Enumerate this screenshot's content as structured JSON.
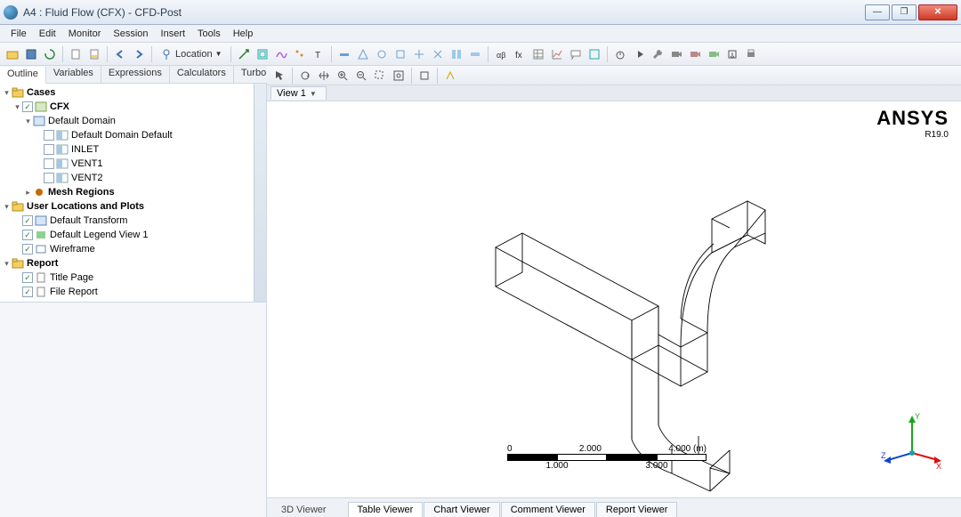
{
  "window": {
    "title": "A4 : Fluid Flow (CFX) - CFD-Post"
  },
  "menu": [
    "File",
    "Edit",
    "Monitor",
    "Session",
    "Insert",
    "Tools",
    "Help"
  ],
  "toolbar": {
    "location_label": "Location"
  },
  "left_tabs": [
    "Outline",
    "Variables",
    "Expressions",
    "Calculators",
    "Turbo"
  ],
  "left_active_tab": 0,
  "tree": [
    {
      "ind": 0,
      "tw": "▾",
      "ck": null,
      "ic": "folder",
      "lbl": "Cases",
      "bold": true
    },
    {
      "ind": 1,
      "tw": "▾",
      "ck": true,
      "ic": "case",
      "lbl": "CFX",
      "bold": true
    },
    {
      "ind": 2,
      "tw": "▾",
      "ck": null,
      "ic": "domain",
      "lbl": "Default Domain",
      "bold": false
    },
    {
      "ind": 3,
      "tw": "",
      "ck": false,
      "ic": "boundary",
      "lbl": "Default Domain Default",
      "bold": false
    },
    {
      "ind": 3,
      "tw": "",
      "ck": false,
      "ic": "boundary",
      "lbl": "INLET",
      "bold": false
    },
    {
      "ind": 3,
      "tw": "",
      "ck": false,
      "ic": "boundary",
      "lbl": "VENT1",
      "bold": false
    },
    {
      "ind": 3,
      "tw": "",
      "ck": false,
      "ic": "boundary",
      "lbl": "VENT2",
      "bold": false
    },
    {
      "ind": 2,
      "tw": "▸",
      "ck": null,
      "ic": "mesh",
      "lbl": "Mesh Regions",
      "bold": true
    },
    {
      "ind": 0,
      "tw": "▾",
      "ck": null,
      "ic": "folder",
      "lbl": "User Locations and Plots",
      "bold": true
    },
    {
      "ind": 1,
      "tw": "",
      "ck": true,
      "ic": "domain",
      "lbl": "Default Transform",
      "bold": false
    },
    {
      "ind": 1,
      "tw": "",
      "ck": true,
      "ic": "legend",
      "lbl": "Default Legend View 1",
      "bold": false
    },
    {
      "ind": 1,
      "tw": "",
      "ck": true,
      "ic": "wire",
      "lbl": "Wireframe",
      "bold": false
    },
    {
      "ind": 0,
      "tw": "▾",
      "ck": null,
      "ic": "folder",
      "lbl": "Report",
      "bold": true
    },
    {
      "ind": 1,
      "tw": "",
      "ck": true,
      "ic": "report",
      "lbl": "Title Page",
      "bold": false
    },
    {
      "ind": 1,
      "tw": "",
      "ck": true,
      "ic": "report",
      "lbl": "File Report",
      "bold": false
    }
  ],
  "view": {
    "tab_label": "View 1",
    "brand_name": "ANSYS",
    "brand_version": "R19.0"
  },
  "scale": {
    "top_ticks": [
      "0",
      "2.000",
      "4.000 (m)"
    ],
    "bottom_ticks": [
      "1.000",
      "3.000"
    ]
  },
  "triad": {
    "x": "X",
    "y": "Y",
    "z": "Z"
  },
  "bottom_tabs": {
    "plain": "3D Viewer",
    "tabs": [
      "Table Viewer",
      "Chart Viewer",
      "Comment Viewer",
      "Report Viewer"
    ]
  }
}
